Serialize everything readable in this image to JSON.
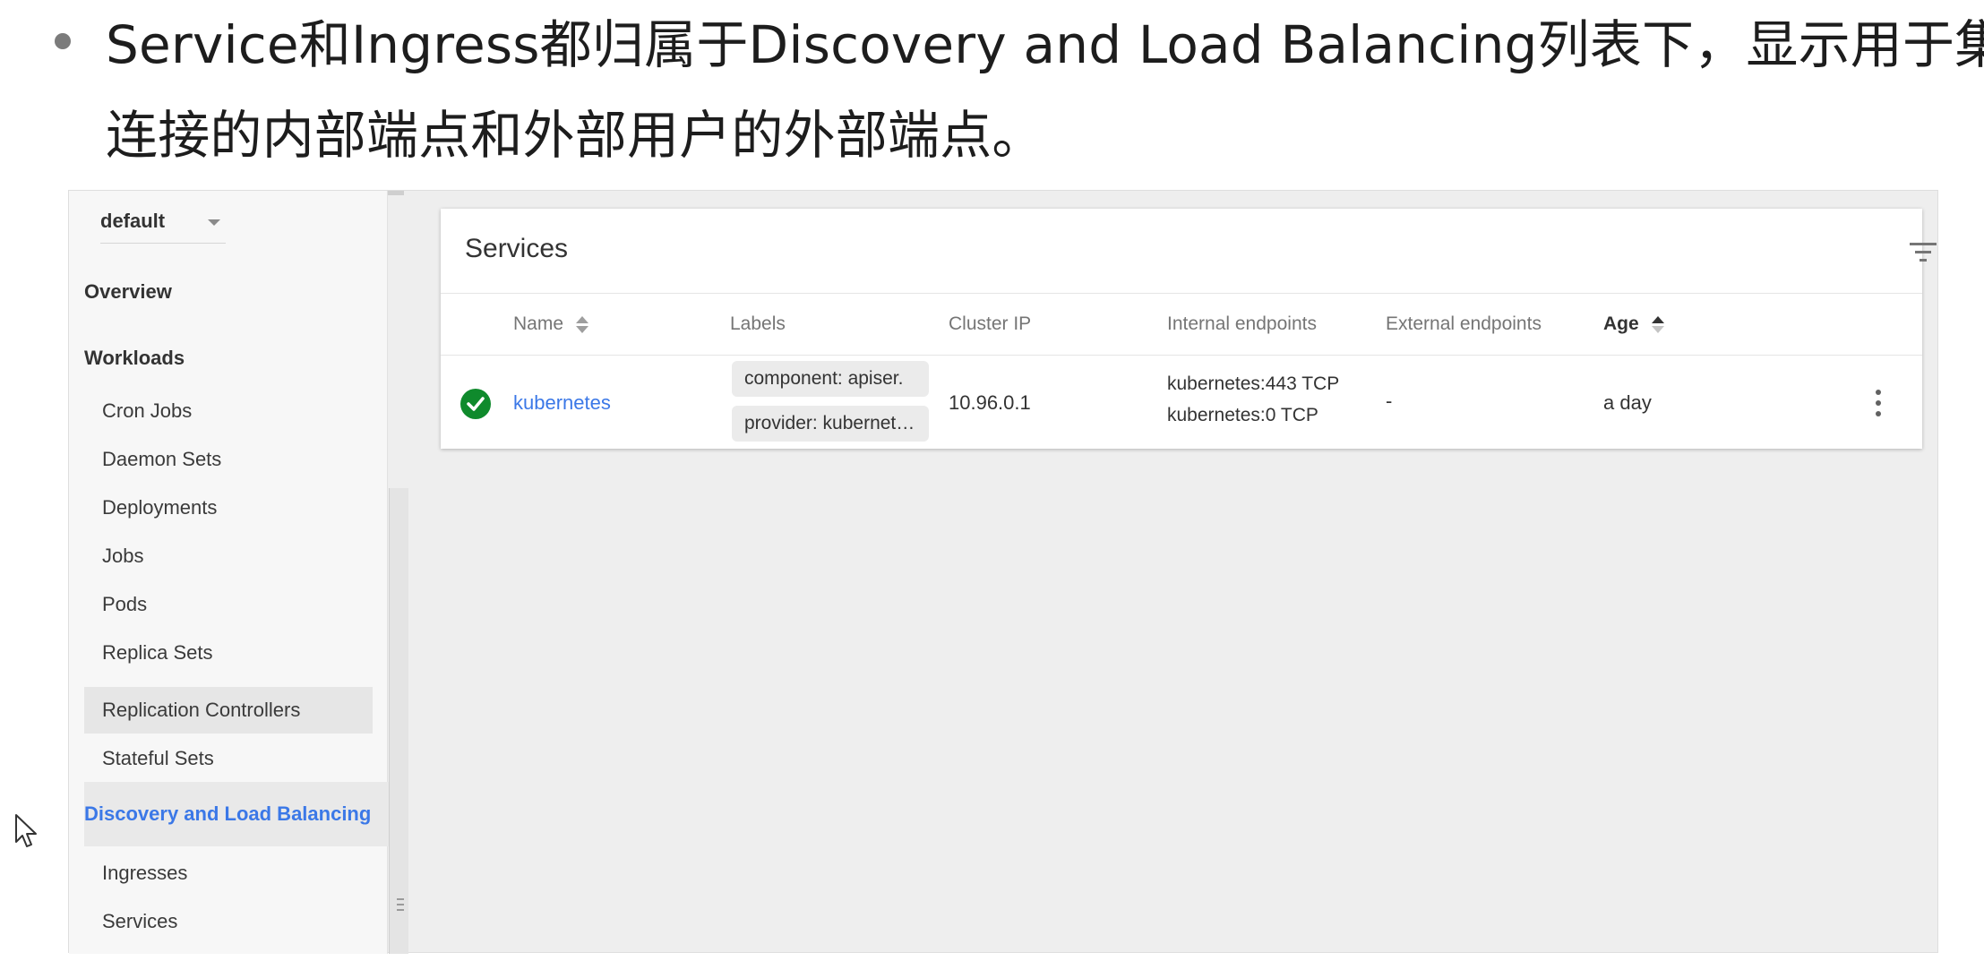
{
  "slide": {
    "bullet_line_1": "Service和Ingress都归属于Discovery and Load Balancing列表下，显示用于集群",
    "bullet_line_2": "连接的内部端点和外部用户的外部端点。"
  },
  "sidebar": {
    "namespace": "default",
    "sections": {
      "overview": "Overview",
      "workloads": "Workloads"
    },
    "workload_items": [
      "Cron Jobs",
      "Daemon Sets",
      "Deployments",
      "Jobs",
      "Pods",
      "Replica Sets",
      "Replication Controllers",
      "Stateful Sets"
    ],
    "active_section": "Discovery and Load Balancing",
    "discovery_items": [
      "Ingresses",
      "Services"
    ]
  },
  "services_card": {
    "title": "Services",
    "columns": {
      "name": "Name",
      "labels": "Labels",
      "cluster_ip": "Cluster IP",
      "internal_endpoints": "Internal endpoints",
      "external_endpoints": "External endpoints",
      "age": "Age"
    },
    "rows": [
      {
        "status": "ok",
        "name": "kubernetes",
        "labels": [
          "component: apiser.",
          "provider: kubernet…"
        ],
        "cluster_ip": "10.96.0.1",
        "internal_endpoints": [
          "kubernetes:443 TCP",
          "kubernetes:0 TCP"
        ],
        "external_endpoints": "-",
        "age": "a day"
      }
    ]
  },
  "icons": {
    "filter": "filter-icon",
    "status_ok": "check-circle-icon",
    "more": "more-vert-icon",
    "sort": "sort-icon",
    "cursor": "mouse-pointer-icon"
  },
  "colors": {
    "link": "#3b78e7",
    "status_ok": "#0f8a2c",
    "background": "#eeeeee"
  }
}
